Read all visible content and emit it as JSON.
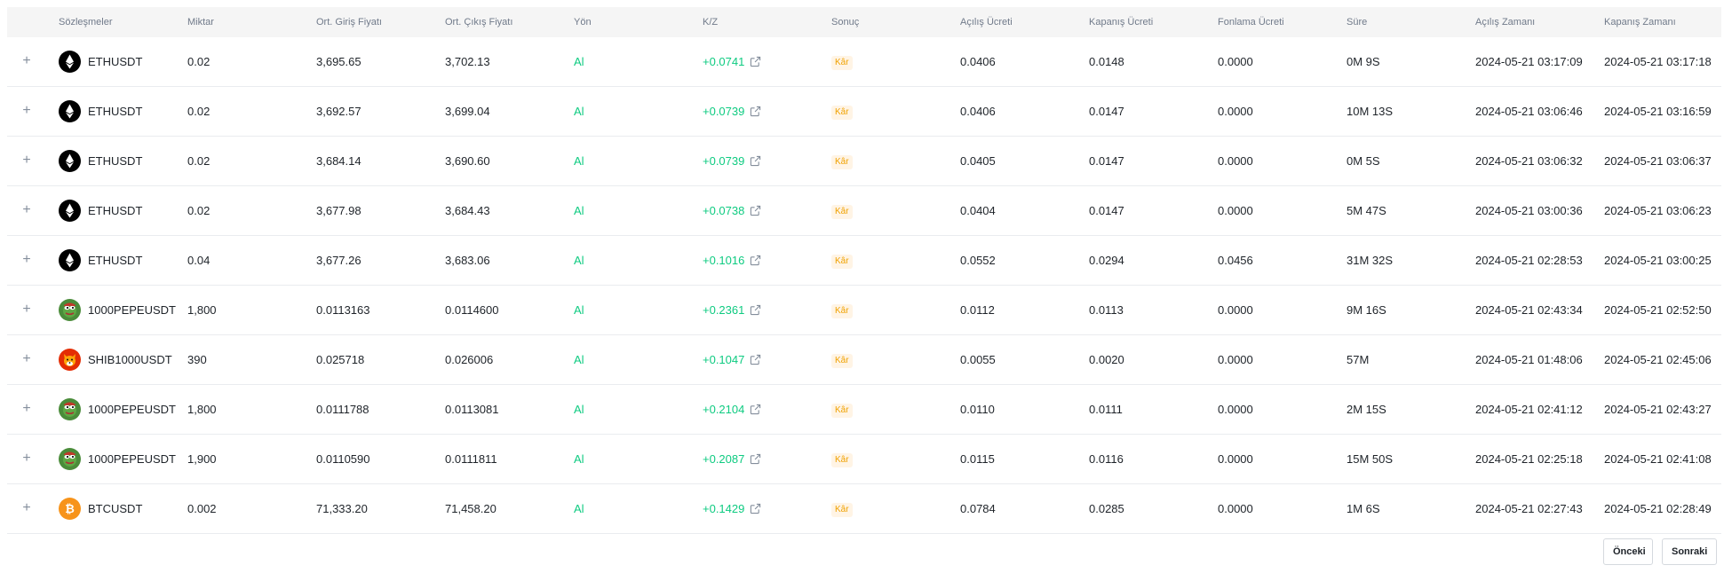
{
  "headers": {
    "contracts": "Sözleşmeler",
    "amount": "Miktar",
    "avg_entry": "Ort. Giriş Fiyatı",
    "avg_exit": "Ort. Çıkış Fiyatı",
    "direction": "Yön",
    "pnl": "K/Z",
    "result": "Sonuç",
    "open_fee": "Açılış Ücreti",
    "close_fee": "Kapanış Ücreti",
    "funding_fee": "Fonlama Ücreti",
    "duration": "Süre",
    "open_time": "Açılış Zamanı",
    "close_time": "Kapanış Zamanı"
  },
  "rows": [
    {
      "symbol": "ETHUSDT",
      "coin": "eth-icon",
      "amount": "0.02",
      "entry": "3,695.65",
      "exit": "3,702.13",
      "dir": "Al",
      "pnl": "+0.0741",
      "result": "Kâr",
      "open_fee": "0.0406",
      "close_fee": "0.0148",
      "funding": "0.0000",
      "duration": "0M 9S",
      "open_time": "2024-05-21 03:17:09",
      "close_time": "2024-05-21 03:17:18"
    },
    {
      "symbol": "ETHUSDT",
      "coin": "eth-icon",
      "amount": "0.02",
      "entry": "3,692.57",
      "exit": "3,699.04",
      "dir": "Al",
      "pnl": "+0.0739",
      "result": "Kâr",
      "open_fee": "0.0406",
      "close_fee": "0.0147",
      "funding": "0.0000",
      "duration": "10M 13S",
      "open_time": "2024-05-21 03:06:46",
      "close_time": "2024-05-21 03:16:59"
    },
    {
      "symbol": "ETHUSDT",
      "coin": "eth-icon",
      "amount": "0.02",
      "entry": "3,684.14",
      "exit": "3,690.60",
      "dir": "Al",
      "pnl": "+0.0739",
      "result": "Kâr",
      "open_fee": "0.0405",
      "close_fee": "0.0147",
      "funding": "0.0000",
      "duration": "0M 5S",
      "open_time": "2024-05-21 03:06:32",
      "close_time": "2024-05-21 03:06:37"
    },
    {
      "symbol": "ETHUSDT",
      "coin": "eth-icon",
      "amount": "0.02",
      "entry": "3,677.98",
      "exit": "3,684.43",
      "dir": "Al",
      "pnl": "+0.0738",
      "result": "Kâr",
      "open_fee": "0.0404",
      "close_fee": "0.0147",
      "funding": "0.0000",
      "duration": "5M 47S",
      "open_time": "2024-05-21 03:00:36",
      "close_time": "2024-05-21 03:06:23"
    },
    {
      "symbol": "ETHUSDT",
      "coin": "eth-icon",
      "amount": "0.04",
      "entry": "3,677.26",
      "exit": "3,683.06",
      "dir": "Al",
      "pnl": "+0.1016",
      "result": "Kâr",
      "open_fee": "0.0552",
      "close_fee": "0.0294",
      "funding": "0.0456",
      "duration": "31M 32S",
      "open_time": "2024-05-21 02:28:53",
      "close_time": "2024-05-21 03:00:25"
    },
    {
      "symbol": "1000PEPEUSDT",
      "coin": "pepe-icon",
      "amount": "1,800",
      "entry": "0.0113163",
      "exit": "0.0114600",
      "dir": "Al",
      "pnl": "+0.2361",
      "result": "Kâr",
      "open_fee": "0.0112",
      "close_fee": "0.0113",
      "funding": "0.0000",
      "duration": "9M 16S",
      "open_time": "2024-05-21 02:43:34",
      "close_time": "2024-05-21 02:52:50"
    },
    {
      "symbol": "SHIB1000USDT",
      "coin": "shib-icon",
      "amount": "390",
      "entry": "0.025718",
      "exit": "0.026006",
      "dir": "Al",
      "pnl": "+0.1047",
      "result": "Kâr",
      "open_fee": "0.0055",
      "close_fee": "0.0020",
      "funding": "0.0000",
      "duration": "57M",
      "open_time": "2024-05-21 01:48:06",
      "close_time": "2024-05-21 02:45:06"
    },
    {
      "symbol": "1000PEPEUSDT",
      "coin": "pepe-icon",
      "amount": "1,800",
      "entry": "0.0111788",
      "exit": "0.0113081",
      "dir": "Al",
      "pnl": "+0.2104",
      "result": "Kâr",
      "open_fee": "0.0110",
      "close_fee": "0.0111",
      "funding": "0.0000",
      "duration": "2M 15S",
      "open_time": "2024-05-21 02:41:12",
      "close_time": "2024-05-21 02:43:27"
    },
    {
      "symbol": "1000PEPEUSDT",
      "coin": "pepe-icon",
      "amount": "1,900",
      "entry": "0.0110590",
      "exit": "0.0111811",
      "dir": "Al",
      "pnl": "+0.2087",
      "result": "Kâr",
      "open_fee": "0.0115",
      "close_fee": "0.0116",
      "funding": "0.0000",
      "duration": "15M 50S",
      "open_time": "2024-05-21 02:25:18",
      "close_time": "2024-05-21 02:41:08"
    },
    {
      "symbol": "BTCUSDT",
      "coin": "btc-icon",
      "amount": "0.002",
      "entry": "71,333.20",
      "exit": "71,458.20",
      "dir": "Al",
      "pnl": "+0.1429",
      "result": "Kâr",
      "open_fee": "0.0784",
      "close_fee": "0.0285",
      "funding": "0.0000",
      "duration": "1M 6S",
      "open_time": "2024-05-21 02:27:43",
      "close_time": "2024-05-21 02:28:49"
    }
  ],
  "pagination": {
    "prev": "Önceki",
    "next": "Sonraki"
  },
  "colors": {
    "positive": "#0ecb81",
    "badge_bg": "#fff4e5",
    "badge_text": "#f0a202",
    "header_bg": "#f5f5f5"
  }
}
